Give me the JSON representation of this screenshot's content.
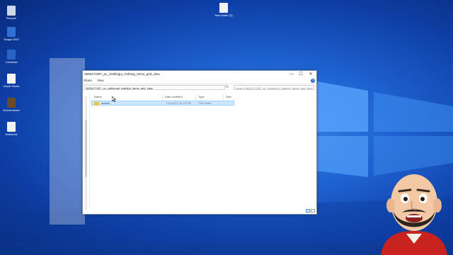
{
  "desktop_icons": [
    {
      "label": "Recycle",
      "color": "#cfd8e6"
    },
    {
      "label": "Snagit 2020",
      "color": "#2f6fd6"
    },
    {
      "label": "Camtasia",
      "color": "#2b63c4"
    },
    {
      "label": "Visual Studio",
      "color": "#f5f5f5"
    },
    {
      "label": "Wondershare",
      "color": "#6a4a2a"
    },
    {
      "label": "Notebook",
      "color": "#f2f2f2"
    },
    {
      "label": "New folder (2)",
      "color": "#f2f2f2"
    }
  ],
  "explorer": {
    "title": "3605471997_pc_clothingui_clothing_items_grid_view",
    "ribbon_tabs": [
      "Share",
      "View"
    ],
    "address": "3605471997_pc_clothingui_clothing_items_grid_view",
    "search_placeholder": "Search 3605471997_pc_clothingui_clothing_items_grid_view",
    "columns": [
      "Name",
      "Date modified",
      "Type",
      "Size"
    ],
    "rows": [
      {
        "name": "meshs",
        "date": "7/22/2022 10:15 PM",
        "type": "File folder",
        "size": ""
      }
    ]
  },
  "icons": {
    "help": "?",
    "refresh": "↻",
    "minimize": "—",
    "maximize": "☐",
    "close": "✕"
  },
  "colors": {
    "desktop_blue": "#1f63d2",
    "selection": "#cce8ff",
    "folder": "#f3c24a"
  }
}
